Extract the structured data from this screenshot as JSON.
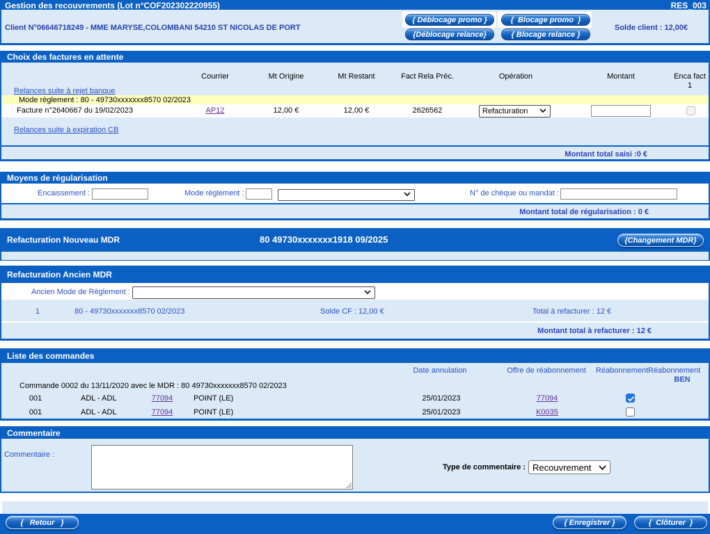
{
  "colors": {
    "primary_blue": "#0b60c4",
    "panel_blue": "#dce9f6",
    "highlight_yellow": "#ffffbe",
    "link_blue": "#2a52c8",
    "visited_purple": "#6b3aa2",
    "checkbox_blue": "#1a73e8"
  },
  "titlebar": {
    "title": "Gestion des recouvrements (Lot n°COF202302220955)",
    "code": "RES_003"
  },
  "client": {
    "label": "Client N°06646718249 - MME MARYSE,COLOMBANI 54210 ST NICOLAS DE PORT",
    "deblocage_promo": "{ Déblocage promo }",
    "blocage_promo": "{  Blocage promo  }",
    "deblocage_relance": "{Déblocage relance}",
    "blocage_relance": "{ Blocage relance }",
    "solde": "Solde client : 12,00€"
  },
  "factures": {
    "title": "Choix des factures en attente",
    "col_courrier": "Courrier",
    "col_mt_origine": "Mt Origine",
    "col_mt_restant": "Mt Restant",
    "col_fact_rela": "Fact Rela Préc.",
    "col_operation": "Opération",
    "col_montant": "Montant",
    "col_enca_1": "Enca fact",
    "col_enca_2": "1",
    "link_rejet": "Relances suite à rejet banque",
    "mode_reglement": "Mode règlement : 80 - 49730xxxxxxx8570 02/2023",
    "row": {
      "label": "Facture n°2640667 du 19/02/2023",
      "courrier": "AP12",
      "mt_origine": "12,00 €",
      "mt_restant": "12,00 €",
      "fact_rela": "2626562",
      "operation": "Refacturation"
    },
    "link_expiration": "Relances suite à expiration CB",
    "total": "Montant total saisi :0 €"
  },
  "regularisation": {
    "title": "Moyens de régularisation",
    "encaissement_label": "Encaissement :",
    "mode_label": "Mode règlement :",
    "cheque_label": "N° de chèque ou mandat :",
    "total": "Montant total de régularisation : 0 €"
  },
  "nouveau_mdr": {
    "title": "Refacturation Nouveau MDR",
    "value": "80 49730xxxxxxx1918 09/2025",
    "button": "{Changement MDR}"
  },
  "ancien_mdr": {
    "title": "Refacturation Ancien MDR",
    "label": "Ancien Mode de Règlement :",
    "row": {
      "num": "1",
      "mdr": "80 - 49730xxxxxxx8570 02/2023",
      "solde": "Solde CF : 12,00 €",
      "total": "Total à refacturer : 12 €"
    },
    "total": "Montant total à refacturer : 12 €"
  },
  "commandes": {
    "title": "Liste des commandes",
    "col_date": "Date annulation",
    "col_offre": "Offre de réabonnement",
    "col_reab": "Réabonnement",
    "col_reab_ben_1": "Réabonnement",
    "col_reab_ben_2": "BEN",
    "header_line": "Commande 0002 du 13/11/2020 avec le MDR : 80 49730xxxxxxx8570 02/2023",
    "rows": [
      {
        "num": "001",
        "type": "ADL - ADL",
        "code": "77094",
        "name": "POINT (LE)",
        "date": "25/01/2023",
        "offre": "77094",
        "checked": true
      },
      {
        "num": "001",
        "type": "ADL - ADL",
        "code": "77094",
        "name": "POINT (LE)",
        "date": "25/01/2023",
        "offre": "K0035",
        "checked": false
      }
    ]
  },
  "commentaire": {
    "title": "Commentaire",
    "label": "Commentaire :",
    "type_label": "Type de commentaire :",
    "type_value": "Recouvrement"
  },
  "footer": {
    "retour": "{   Retour   }",
    "enregistrer": "{ Enregistrer }",
    "cloturer": "{  Clôturer  }"
  }
}
